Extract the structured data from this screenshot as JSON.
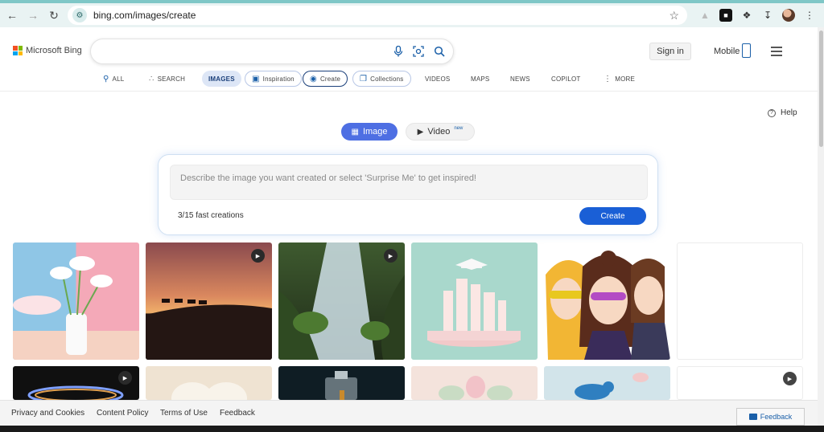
{
  "browser": {
    "url": "bing.com/images/create"
  },
  "header": {
    "logo_text": "Microsoft Bing",
    "signin_label": "Sign in",
    "mobile_label": "Mobile"
  },
  "tabs": [
    {
      "label": "ALL",
      "icon": "search-icon"
    },
    {
      "label": "SEARCH",
      "icon": "copilot-icon"
    },
    {
      "label": "IMAGES",
      "icon": ""
    },
    {
      "label": "Inspiration",
      "icon": "image-icon"
    },
    {
      "label": "Create",
      "icon": "create-icon"
    },
    {
      "label": "Collections",
      "icon": "collections-icon"
    },
    {
      "label": "VIDEOS",
      "icon": ""
    },
    {
      "label": "MAPS",
      "icon": ""
    },
    {
      "label": "NEWS",
      "icon": ""
    },
    {
      "label": "COPILOT",
      "icon": ""
    },
    {
      "label": "MORE",
      "icon": "more-dots-icon"
    }
  ],
  "main": {
    "help_label": "Help",
    "mode_image_label": "Image",
    "mode_video_label": "Video",
    "new_badge": "new",
    "prompt_placeholder": "Describe the image you want created or select 'Surprise Me' to get inspired!",
    "boosts_text": "3/15 fast creations",
    "create_label": "Create"
  },
  "footer": {
    "links": [
      "Privacy and Cookies",
      "Content Policy",
      "Terms of Use",
      "Feedback"
    ],
    "feedback_button": "Feedback"
  },
  "colors": {
    "accent": "#1a5fd6",
    "mode_active": "#4e6fe3"
  }
}
